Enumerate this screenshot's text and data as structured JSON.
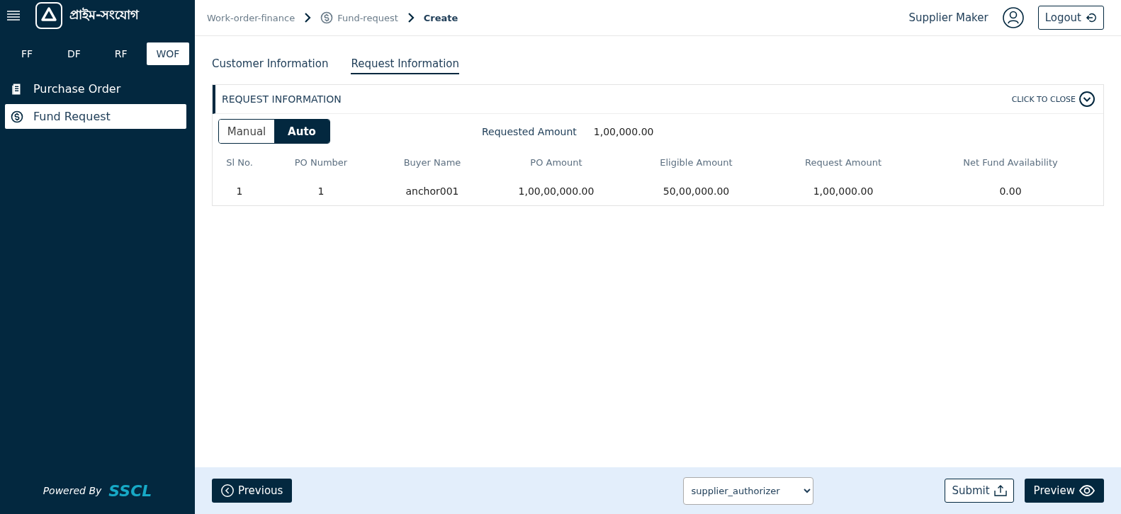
{
  "sidebar": {
    "brand": "প্রাইম-সংযোগ",
    "product_tabs": [
      {
        "label": "FF",
        "selected": false
      },
      {
        "label": "DF",
        "selected": false
      },
      {
        "label": "RF",
        "selected": false
      },
      {
        "label": "WOF",
        "selected": true
      }
    ],
    "items": [
      {
        "label": "Purchase Order",
        "selected": false
      },
      {
        "label": "Fund Request",
        "selected": true
      }
    ],
    "footer": {
      "prefix": "Powered By",
      "brand": "SSCL"
    }
  },
  "header": {
    "breadcrumb": [
      {
        "label": "Work-order-finance",
        "current": false
      },
      {
        "label": "Fund-request",
        "current": false
      },
      {
        "label": "Create",
        "current": true
      }
    ],
    "user": "Supplier Maker",
    "logout": "Logout"
  },
  "tabs": [
    {
      "label": "Customer Information",
      "selected": false
    },
    {
      "label": "Request Information",
      "selected": true
    }
  ],
  "panel": {
    "title": "REQUEST INFORMATION",
    "toggle": "CLICK TO CLOSE",
    "expanded": true,
    "mode": [
      {
        "label": "Manual",
        "selected": false
      },
      {
        "label": "Auto",
        "selected": true
      }
    ],
    "requested_amount": {
      "label": "Requested Amount",
      "value": "1,00,000.00"
    },
    "table": {
      "columns": [
        "Sl No.",
        "PO Number",
        "Buyer Name",
        "PO Amount",
        "Eligible Amount",
        "Request Amount",
        "Net Fund Availability"
      ],
      "rows": [
        [
          "1",
          "1",
          "anchor001",
          "1,00,00,000.00",
          "50,00,000.00",
          "1,00,000.00",
          "0.00"
        ]
      ]
    }
  },
  "footer": {
    "previous": "Previous",
    "select_value": "supplier_authorizer",
    "submit": "Submit",
    "preview": "Preview"
  }
}
